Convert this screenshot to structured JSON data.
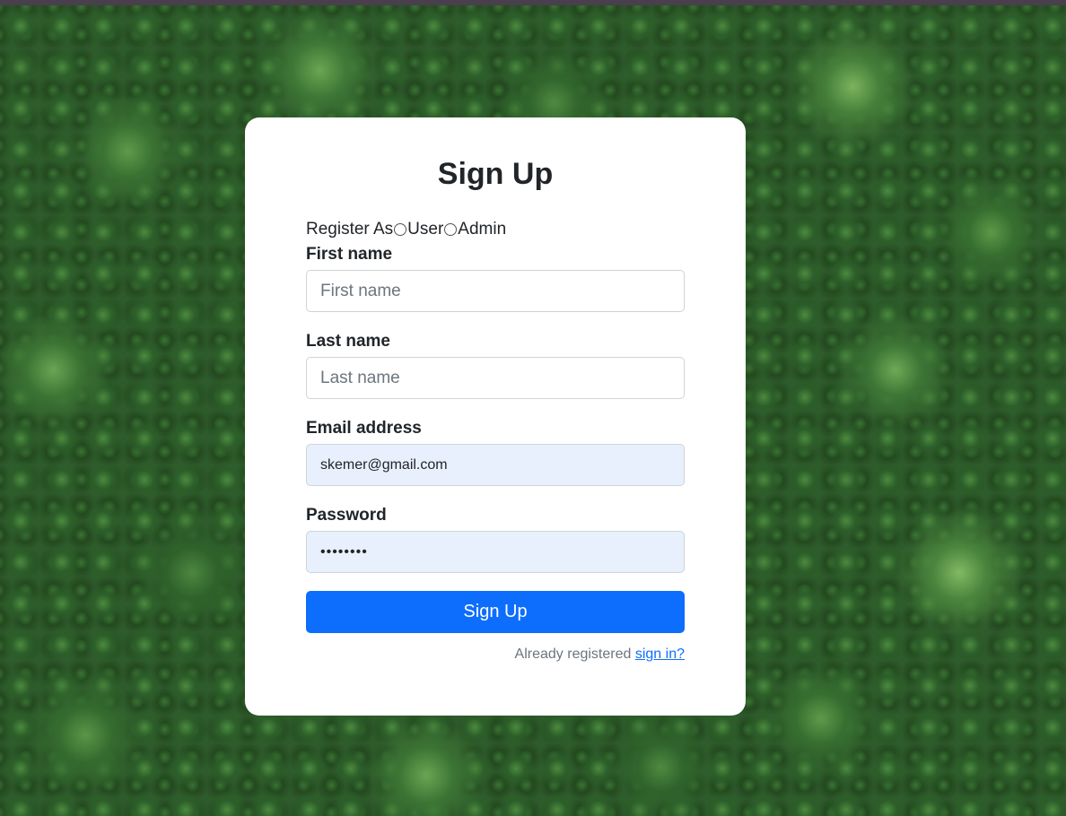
{
  "form": {
    "title": "Sign Up",
    "register_as_label": "Register As",
    "roles": [
      {
        "label": "User",
        "selected": false
      },
      {
        "label": "Admin",
        "selected": false
      }
    ],
    "first_name": {
      "label": "First name",
      "placeholder": "First name",
      "value": ""
    },
    "last_name": {
      "label": "Last name",
      "placeholder": "Last name",
      "value": ""
    },
    "email": {
      "label": "Email address",
      "value": "skemer@gmail.com"
    },
    "password": {
      "label": "Password",
      "value": "********"
    },
    "submit_label": "Sign Up",
    "already_registered_text": "Already registered",
    "sign_in_link": "sign in?"
  },
  "colors": {
    "primary": "#0d6efd",
    "autofill_bg": "#e8f0fe",
    "card_bg": "#ffffff",
    "text": "#212529",
    "muted": "#6c757d"
  }
}
